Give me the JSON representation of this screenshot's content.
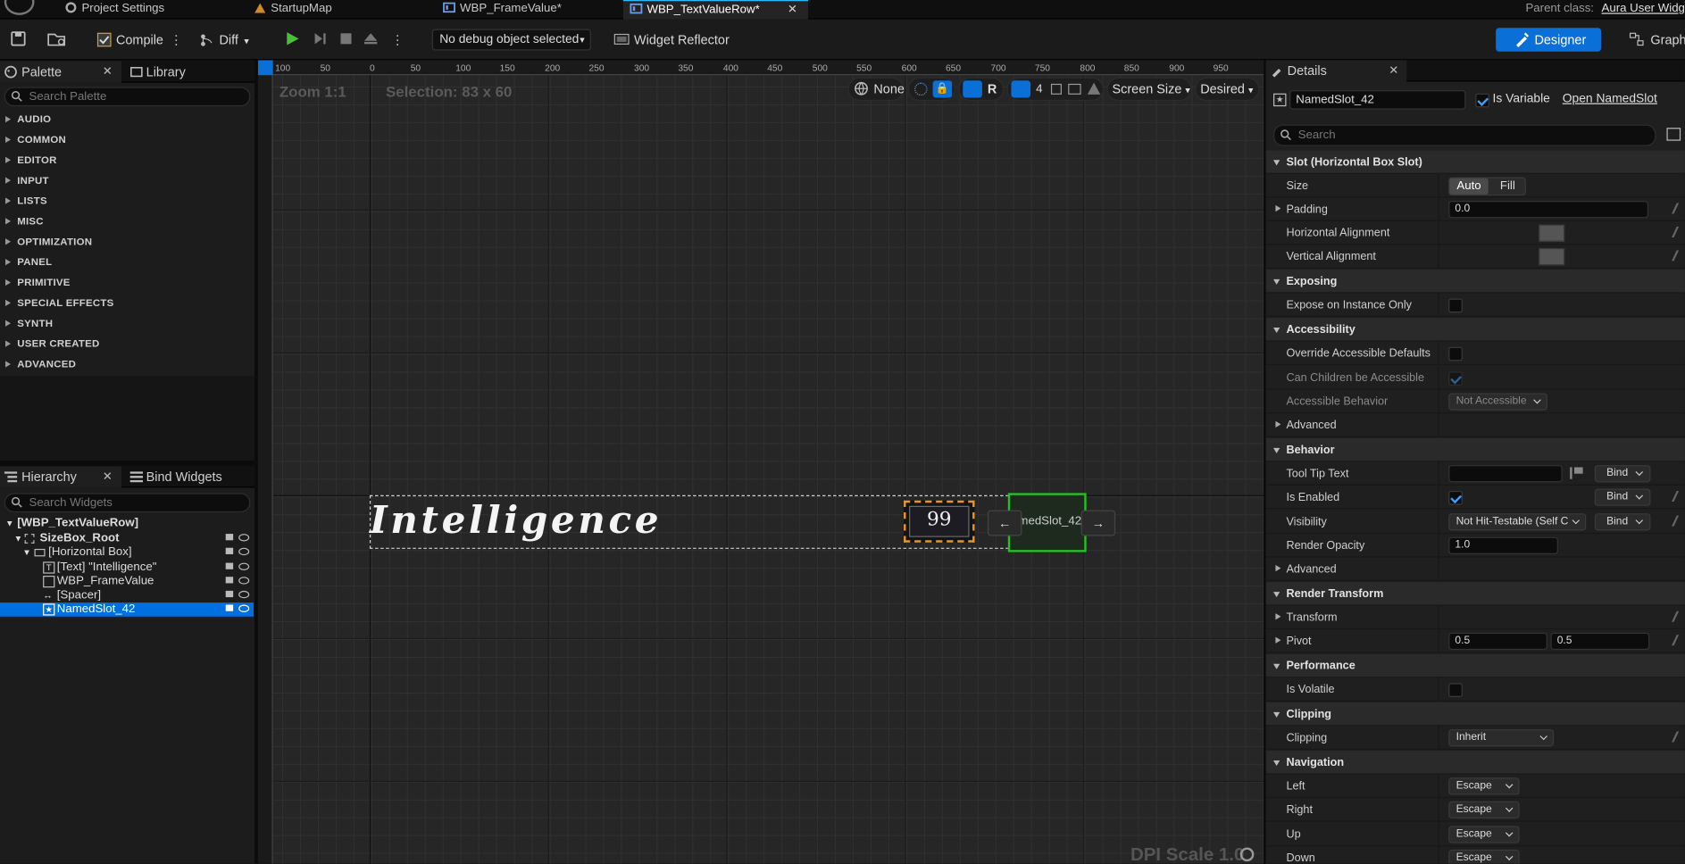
{
  "tabs": [
    {
      "label": "Project Settings",
      "active": false
    },
    {
      "label": "StartupMap",
      "active": false
    },
    {
      "label": "WBP_FrameValue*",
      "active": false
    },
    {
      "label": "WBP_TextValueRow*",
      "active": true
    }
  ],
  "parent_class": {
    "label": "Parent class:",
    "value": "Aura User Widg"
  },
  "toolbar": {
    "compile": "Compile",
    "diff": "Diff",
    "debug_object": "No debug object selected",
    "widget_reflector": "Widget Reflector",
    "designer": "Designer",
    "graph": "Graph"
  },
  "palette": {
    "tab": "Palette",
    "library_tab": "Library",
    "search_placeholder": "Search Palette",
    "categories": [
      "AUDIO",
      "COMMON",
      "EDITOR",
      "INPUT",
      "LISTS",
      "MISC",
      "OPTIMIZATION",
      "PANEL",
      "PRIMITIVE",
      "SPECIAL EFFECTS",
      "SYNTH",
      "USER CREATED",
      "ADVANCED"
    ]
  },
  "hierarchy": {
    "tab": "Hierarchy",
    "bind_tab": "Bind Widgets",
    "search_placeholder": "Search Widgets",
    "items": [
      {
        "label": "[WBP_TextValueRow]",
        "bold": true
      },
      {
        "label": "SizeBox_Root",
        "bold": true
      },
      {
        "label": "[Horizontal Box]",
        "bold": false
      },
      {
        "label": "[Text] \"Intelligence\"",
        "bold": false
      },
      {
        "label": "WBP_FrameValue",
        "bold": false
      },
      {
        "label": "[Spacer]",
        "bold": false
      },
      {
        "label": "NamedSlot_42",
        "bold": false,
        "selected": true
      }
    ]
  },
  "canvas": {
    "zoom": "Zoom 1:1",
    "selection": "Selection: 83 x 60",
    "none_label": "None",
    "r_label": "R",
    "grid_count": "4",
    "screen_size": "Screen Size",
    "desired": "Desired",
    "dpi_scale": "DPI Scale 1.0",
    "ruler_labels": [
      "100",
      "50",
      "0",
      "50",
      "100",
      "150",
      "200",
      "250",
      "300",
      "350",
      "400",
      "450",
      "500",
      "550",
      "600",
      "650",
      "700",
      "750",
      "800",
      "850",
      "900",
      "950"
    ],
    "widget_text": "Intelligence",
    "frame_value": "99",
    "slot_label": "NamedSlot_42",
    "slot_left_arrow": "←",
    "slot_right_arrow": "→"
  },
  "details": {
    "tab": "Details",
    "name_value": "NamedSlot_42",
    "is_variable": "Is Variable",
    "open_link": "Open NamedSlot",
    "search_placeholder": "Search",
    "slot_section": "Slot (Horizontal Box Slot)",
    "size_label": "Size",
    "size_auto": "Auto",
    "size_fill": "Fill",
    "padding_label": "Padding",
    "padding_value": "0.0",
    "halign_label": "Horizontal Alignment",
    "valign_label": "Vertical Alignment",
    "exposing_section": "Exposing",
    "expose_label": "Expose on Instance Only",
    "accessibility_section": "Accessibility",
    "override_label": "Override Accessible Defaults",
    "children_label": "Can Children be Accessible",
    "behavior_access_label": "Accessible Behavior",
    "behavior_access_value": "Not Accessible",
    "advanced_label": "Advanced",
    "behavior_section": "Behavior",
    "tooltip_label": "Tool Tip Text",
    "bind": "Bind",
    "enabled_label": "Is Enabled",
    "visibility_label": "Visibility",
    "visibility_value": "Not Hit-Testable (Self C",
    "opacity_label": "Render Opacity",
    "opacity_value": "1.0",
    "advanced2_label": "Advanced",
    "render_section": "Render Transform",
    "transform_label": "Transform",
    "pivot_label": "Pivot",
    "pivot_x": "0.5",
    "pivot_y": "0.5",
    "performance_section": "Performance",
    "volatile_label": "Is Volatile",
    "clipping_section": "Clipping",
    "clipping_label": "Clipping",
    "clipping_value": "Inherit",
    "navigation_section": "Navigation",
    "nav_left_label": "Left",
    "nav_right_label": "Right",
    "nav_up_label": "Up",
    "nav_down_label": "Down",
    "escape": "Escape"
  },
  "colors": {
    "accent": "#0070e0",
    "selection_orange": "#e8952a",
    "slot_green": "#22c222",
    "designer_btn": "#0a6fd6"
  }
}
